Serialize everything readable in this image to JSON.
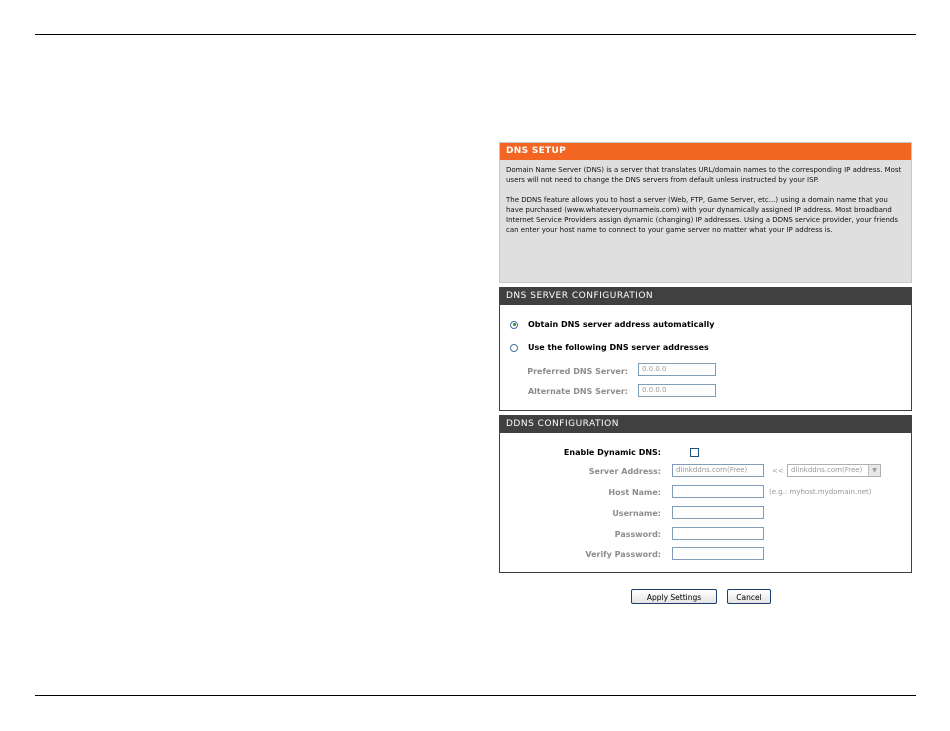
{
  "dns_setup": {
    "title": "DNS SETUP",
    "paragraph1": "Domain Name Server (DNS) is a server that translates URL/domain names to the corresponding IP address. Most users will not need to change the DNS servers from default unless instructed by your ISP.",
    "paragraph2": "The DDNS feature allows you to host a server (Web, FTP, Game Server, etc...) using a domain name that you have purchased (www.whateveryournameis.com) with your dynamically assigned IP address. Most broadband Internet Service Providers assign dynamic (changing) IP addresses. Using a DDNS service provider, your friends can enter your host name to connect to your game server no matter what your IP address is."
  },
  "dns_server_config": {
    "title": "DNS SERVER CONFIGURATION",
    "option_auto": "Obtain DNS server address automatically",
    "option_manual": "Use the following DNS server addresses",
    "selected": "auto",
    "preferred_label": "Preferred DNS Server:",
    "preferred_value": "0.0.0.0",
    "alternate_label": "Alternate DNS Server:",
    "alternate_value": "0.0.0.0"
  },
  "ddns_config": {
    "title": "DDNS CONFIGURATION",
    "enable_label": "Enable Dynamic DNS:",
    "enable_checked": false,
    "server_address_label": "Server Address:",
    "server_address_value": "dlinkddns.com(Free)",
    "server_arrow": "<<",
    "server_select_value": "dlinkddns.com(Free)",
    "host_name_label": "Host Name:",
    "host_name_hint": "(e.g.: myhost.mydomain.net)",
    "username_label": "Username:",
    "password_label": "Password:",
    "verify_password_label": "Verify Password:"
  },
  "buttons": {
    "apply": "Apply Settings",
    "cancel": "Cancel"
  },
  "icons": {
    "select_arrow": "chevron-down-icon"
  },
  "colors": {
    "accent": "#f26522",
    "section_header": "#404040"
  }
}
